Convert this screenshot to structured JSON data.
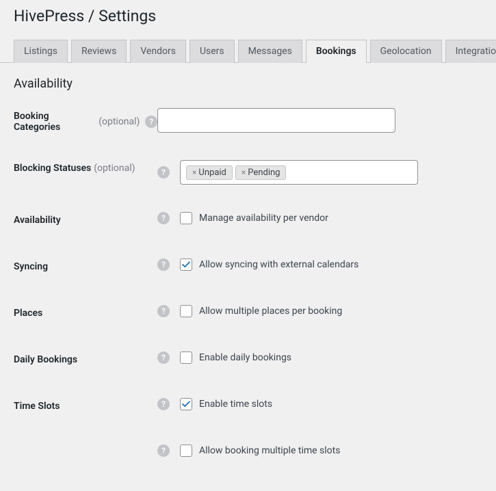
{
  "header": {
    "title": "HivePress / Settings"
  },
  "tabs": [
    {
      "label": "Listings"
    },
    {
      "label": "Reviews"
    },
    {
      "label": "Vendors"
    },
    {
      "label": "Users"
    },
    {
      "label": "Messages"
    },
    {
      "label": "Bookings"
    },
    {
      "label": "Geolocation"
    },
    {
      "label": "Integrations"
    }
  ],
  "section": {
    "title": "Availability"
  },
  "fields": {
    "booking_categories": {
      "label": "Booking Categories",
      "optional": "(optional)"
    },
    "blocking_statuses": {
      "label": "Blocking Statuses",
      "optional": "(optional)",
      "tags": [
        "Unpaid",
        "Pending"
      ]
    },
    "availability": {
      "label": "Availability",
      "text": "Manage availability per vendor",
      "checked": false
    },
    "syncing": {
      "label": "Syncing",
      "text": "Allow syncing with external calendars",
      "checked": true
    },
    "places": {
      "label": "Places",
      "text": "Allow multiple places per booking",
      "checked": false
    },
    "daily_bookings": {
      "label": "Daily Bookings",
      "text": "Enable daily bookings",
      "checked": false
    },
    "time_slots": {
      "label": "Time Slots",
      "text": "Enable time slots",
      "checked": true
    },
    "multiple_slots": {
      "text": "Allow booking multiple time slots",
      "checked": false
    }
  }
}
